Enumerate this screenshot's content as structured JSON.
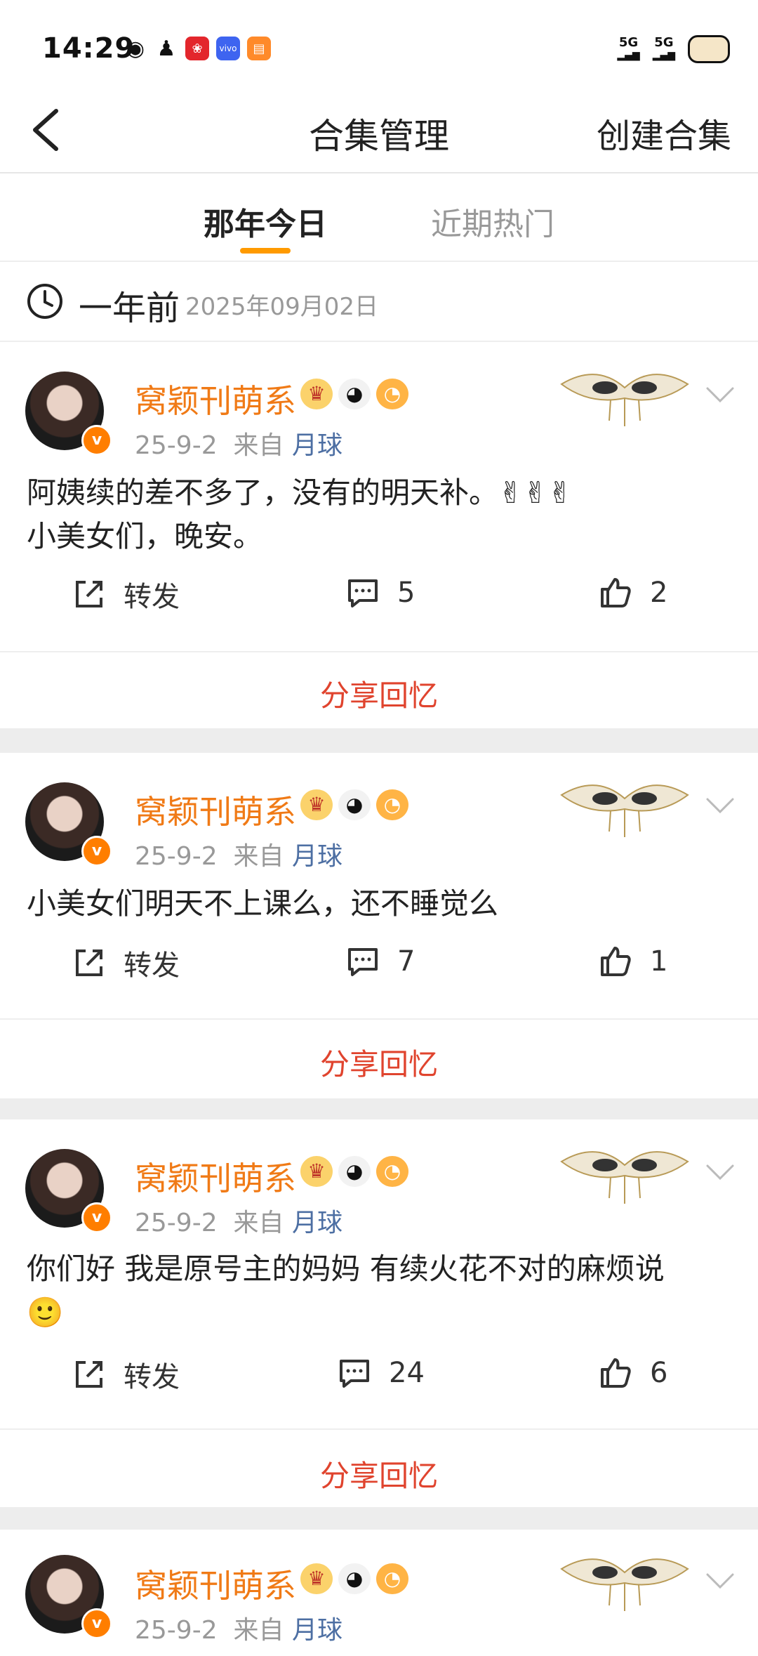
{
  "status_bar": {
    "time": "14:29",
    "signal1": "5G",
    "signal2": "5G"
  },
  "nav": {
    "title": "合集管理",
    "action": "创建合集"
  },
  "tabs": [
    {
      "label": "那年今日",
      "active": true
    },
    {
      "label": "近期热门",
      "active": false
    }
  ],
  "date_header": {
    "ago": "一年前",
    "date": "2025年09月02日"
  },
  "colors": {
    "accent": "#ff9a00",
    "username": "#f07a16",
    "share": "#e0442e",
    "source_link": "#4d6fa3"
  },
  "posts": [
    {
      "username": "窝颖刊萌系",
      "date": "25-9-2",
      "from_label": "来自",
      "source": "月球",
      "content": "阿姨续的差不多了，没有的明天补。✌✌✌\n小美女们，晚安。",
      "repost_label": "转发",
      "comments": "5",
      "likes": "2",
      "share_label": "分享回忆"
    },
    {
      "username": "窝颖刊萌系",
      "date": "25-9-2",
      "from_label": "来自",
      "source": "月球",
      "content": "小美女们明天不上课么，还不睡觉么",
      "repost_label": "转发",
      "comments": "7",
      "likes": "1",
      "share_label": "分享回忆"
    },
    {
      "username": "窝颖刊萌系",
      "date": "25-9-2",
      "from_label": "来自",
      "source": "月球",
      "content": "你们好 我是原号主的妈妈 有续火花不对的麻烦说\n🙂",
      "repost_label": "转发",
      "comments": "24",
      "likes": "6",
      "share_label": "分享回忆"
    },
    {
      "username": "窝颖刊萌系",
      "date": "25-9-2",
      "from_label": "来自",
      "source": "月球"
    }
  ]
}
